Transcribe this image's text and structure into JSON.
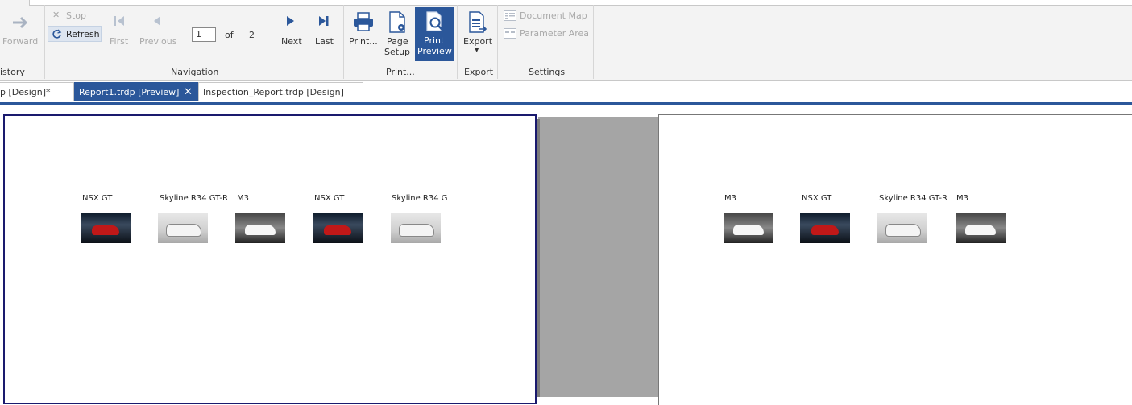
{
  "ribbon": {
    "history": {
      "forward_label": "Forward",
      "group_label": "istory"
    },
    "navigation": {
      "stop_label": "Stop",
      "refresh_label": "Refresh",
      "first_label": "First",
      "previous_label": "Previous",
      "page_value": "1",
      "of_label": "of",
      "page_total": "2",
      "next_label": "Next",
      "last_label": "Last",
      "group_label": "Navigation"
    },
    "print": {
      "print_label": "Print...",
      "page_setup_line1": "Page",
      "page_setup_line2": "Setup",
      "print_preview_line1": "Print",
      "print_preview_line2": "Preview",
      "group_label": "Print..."
    },
    "export": {
      "export_label": "Export",
      "group_label": "Export"
    },
    "settings": {
      "document_map_label": "Document Map",
      "parameter_area_label": "Parameter Area",
      "group_label": "Settings"
    }
  },
  "tabs": [
    {
      "label": "p [Design]*"
    },
    {
      "label": "Report1.trdp [Preview]"
    },
    {
      "label": "Inspection_Report.trdp [Design]"
    }
  ],
  "page1": {
    "cars": [
      {
        "label": "NSX GT",
        "image": "red-car"
      },
      {
        "label": "Skyline R34 GT-R",
        "image": "white-car"
      },
      {
        "label": "M3",
        "image": "m3-car"
      },
      {
        "label": "NSX GT",
        "image": "red-car"
      },
      {
        "label": "Skyline R34 G",
        "image": "white-car"
      }
    ]
  },
  "page2": {
    "cars": [
      {
        "label": "M3",
        "image": "m3-car"
      },
      {
        "label": "NSX GT",
        "image": "red-car"
      },
      {
        "label": "Skyline R34 GT-R",
        "image": "white-car"
      },
      {
        "label": "M3",
        "image": "m3-car"
      }
    ]
  },
  "colors": {
    "accent": "#2b579a",
    "ribbon_bg": "#f3f3f3",
    "viewer_gray": "#a5a5a5"
  }
}
